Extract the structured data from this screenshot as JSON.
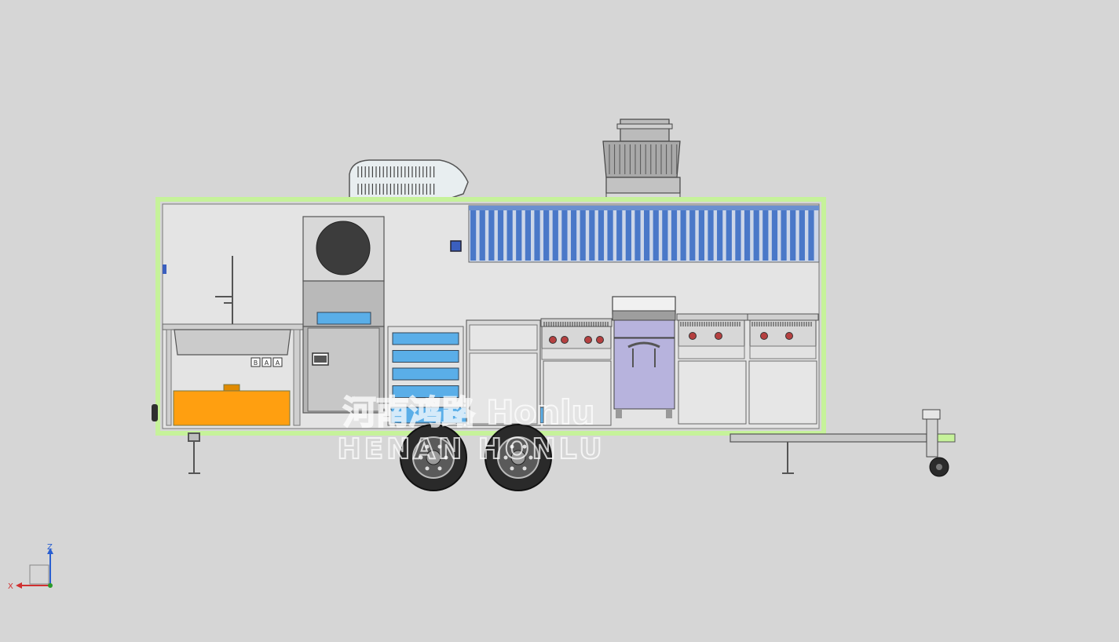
{
  "watermark": {
    "line1": "河南鸿路 Honlu",
    "line2": "HENAN HONLU"
  },
  "sink_buttons": [
    "B",
    "A",
    "A"
  ],
  "axis_triad": {
    "z_label": "Z",
    "x_label": "X"
  },
  "counts": {
    "vent_slats": 38,
    "fridge_drawers": 4,
    "wheels": 2
  },
  "colors": {
    "background": "#d6d6d6",
    "frame": "#c6f29a",
    "panel": "#e4e4e4",
    "water_tank": "#ff9f10",
    "oven_purple": "#b7b3dd",
    "drawer_blue": "#5aaee8",
    "vent_blue": "#4a78c8",
    "tire": "#2a2a2a"
  }
}
